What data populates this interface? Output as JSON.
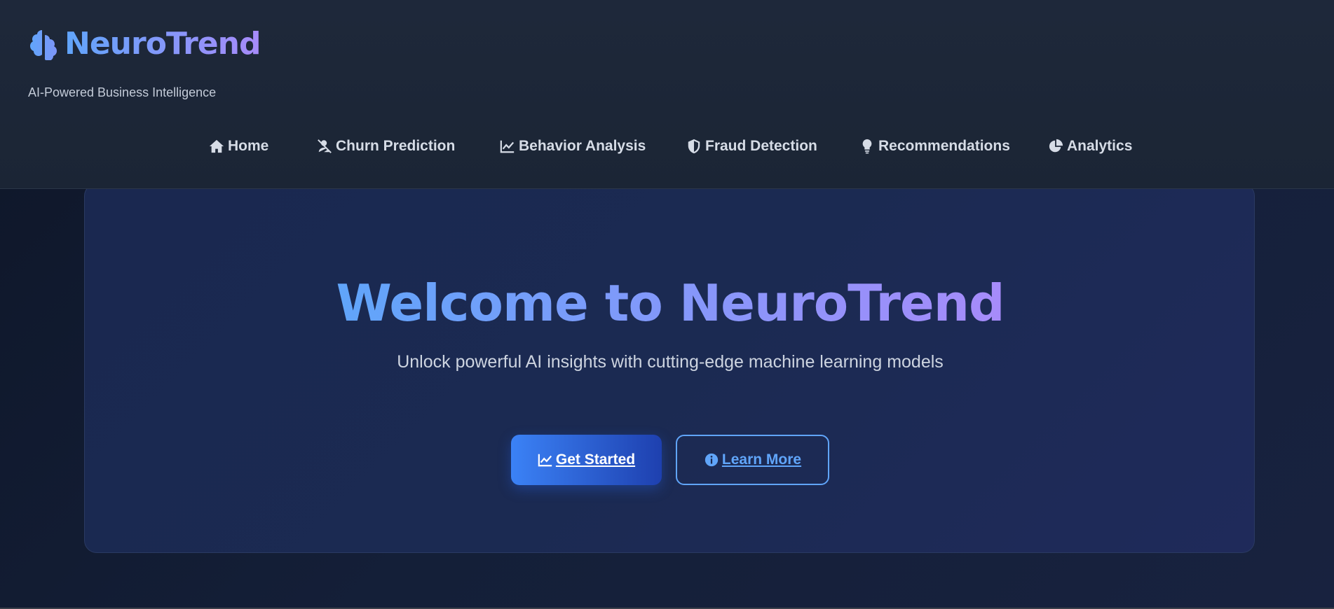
{
  "header": {
    "brand_name": "NeuroTrend",
    "tagline": "AI-Powered Business Intelligence"
  },
  "nav": {
    "items": [
      {
        "label": "Home",
        "icon": "home-icon"
      },
      {
        "label": "Churn Prediction",
        "icon": "user-slash-icon"
      },
      {
        "label": "Behavior Analysis",
        "icon": "line-chart-icon"
      },
      {
        "label": "Fraud Detection",
        "icon": "shield-icon"
      },
      {
        "label": "Recommendations",
        "icon": "lightbulb-icon"
      },
      {
        "label": "Analytics",
        "icon": "pie-chart-icon"
      }
    ]
  },
  "hero": {
    "title": "Welcome to NeuroTrend",
    "subtitle": "Unlock powerful AI insights with cutting-edge machine learning models",
    "primary_button": "Get Started",
    "secondary_button": "Learn More"
  },
  "colors": {
    "accent_start": "#60a5fa",
    "accent_end": "#a78bfa",
    "primary_button": "#3b82f6",
    "header_bg": "#1e283a"
  }
}
